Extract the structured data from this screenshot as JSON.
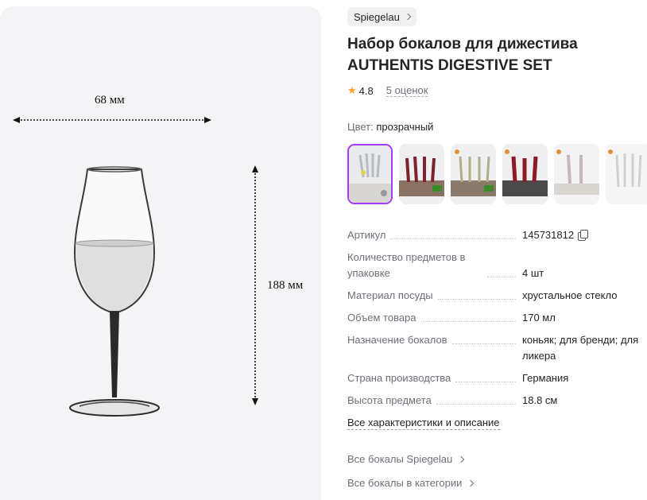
{
  "image": {
    "width_label": "68 мм",
    "height_label": "188 мм"
  },
  "brand": {
    "name": "Spiegelau"
  },
  "product": {
    "title": "Набор бокалов для дижестива AUTHENTIS DIGESTIVE SET",
    "rating": "4.8",
    "reviews": "5 оценок"
  },
  "color": {
    "label": "Цвет:",
    "value": "прозрачный"
  },
  "specs": [
    {
      "key": "Артикул",
      "value": "145731812"
    },
    {
      "key": "Количество предметов в упаковке",
      "value": "4 шт"
    },
    {
      "key": "Материал посуды",
      "value": "хрустальное стекло"
    },
    {
      "key": "Объем товара",
      "value": "170 мл"
    },
    {
      "key": "Назначение бокалов",
      "value": "коньяк; для бренди; для ликера"
    },
    {
      "key": "Страна производства",
      "value": "Германия"
    },
    {
      "key": "Высота предмета",
      "value": "18.8 см"
    }
  ],
  "links": {
    "all_specs": "Все характеристики и описание",
    "brand_link": "Все бокалы Spiegelau",
    "category_link": "Все бокалы в категории"
  },
  "colors": {
    "accent": "#a73afd",
    "star": "#ff9f2e"
  }
}
